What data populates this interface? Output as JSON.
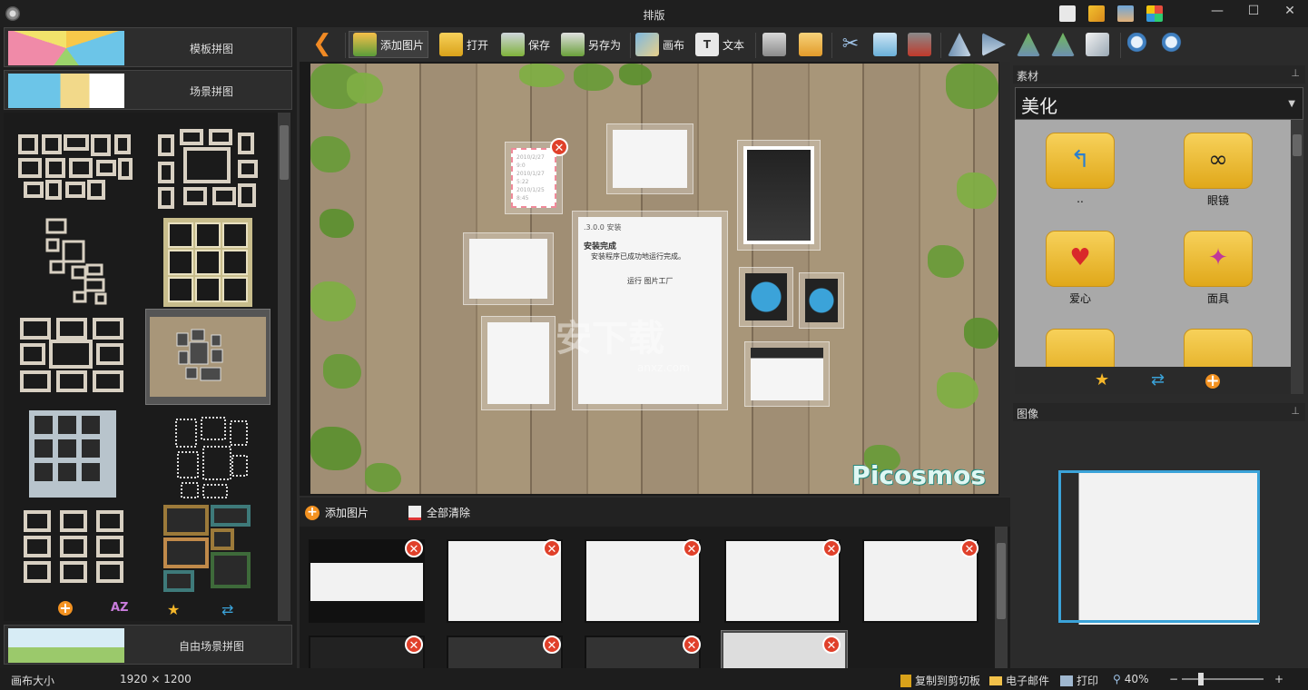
{
  "window": {
    "title": "排版",
    "min": "—",
    "max": "☐",
    "close": "✕"
  },
  "left": {
    "categories": [
      {
        "label": "模板拼图"
      },
      {
        "label": "场景拼图"
      },
      {
        "label": "自由场景拼图"
      }
    ],
    "tools": {
      "add": "+",
      "sort": "AZ",
      "star": "★",
      "refresh": "⇄"
    }
  },
  "toolbar": {
    "add_image": "添加图片",
    "open": "打开",
    "save": "保存",
    "save_as": "另存为",
    "canvas": "画布",
    "text": "文本"
  },
  "canvas": {
    "brand_text": "Picosmos",
    "watermark": "安下载",
    "watermark_sub": "anxz.com",
    "note_lines": [
      "2010/2/27 9:0",
      "2010/1/27 5:22",
      "2010/1/25 8:45"
    ],
    "dialog_title": ".3.0.0 安装",
    "dialog_heading": "安装完成",
    "dialog_text": "安装程序已成功地运行完成。",
    "dialog_check": "运行 图片工厂"
  },
  "strip": {
    "add_label": "添加图片",
    "clear_label": "全部清除",
    "close_glyph": "✕"
  },
  "right": {
    "material_title": "素材",
    "category_selected": "美化",
    "materials": [
      {
        "name": "..",
        "icon": "up-arrow-icon"
      },
      {
        "name": "眼镜",
        "icon": "glasses-icon"
      },
      {
        "name": "爱心",
        "icon": "heart-icon"
      },
      {
        "name": "面具",
        "icon": "mask-icon"
      }
    ],
    "image_title": "图像",
    "pin": "⊥"
  },
  "status": {
    "canvas_size_label": "画布大小",
    "canvas_size_value": "1920 × 1200",
    "copy_clipboard": "复制到剪切板",
    "email": "电子邮件",
    "print": "打印",
    "zoom": "40%",
    "zoom_minus": "−",
    "zoom_plus": "+"
  }
}
